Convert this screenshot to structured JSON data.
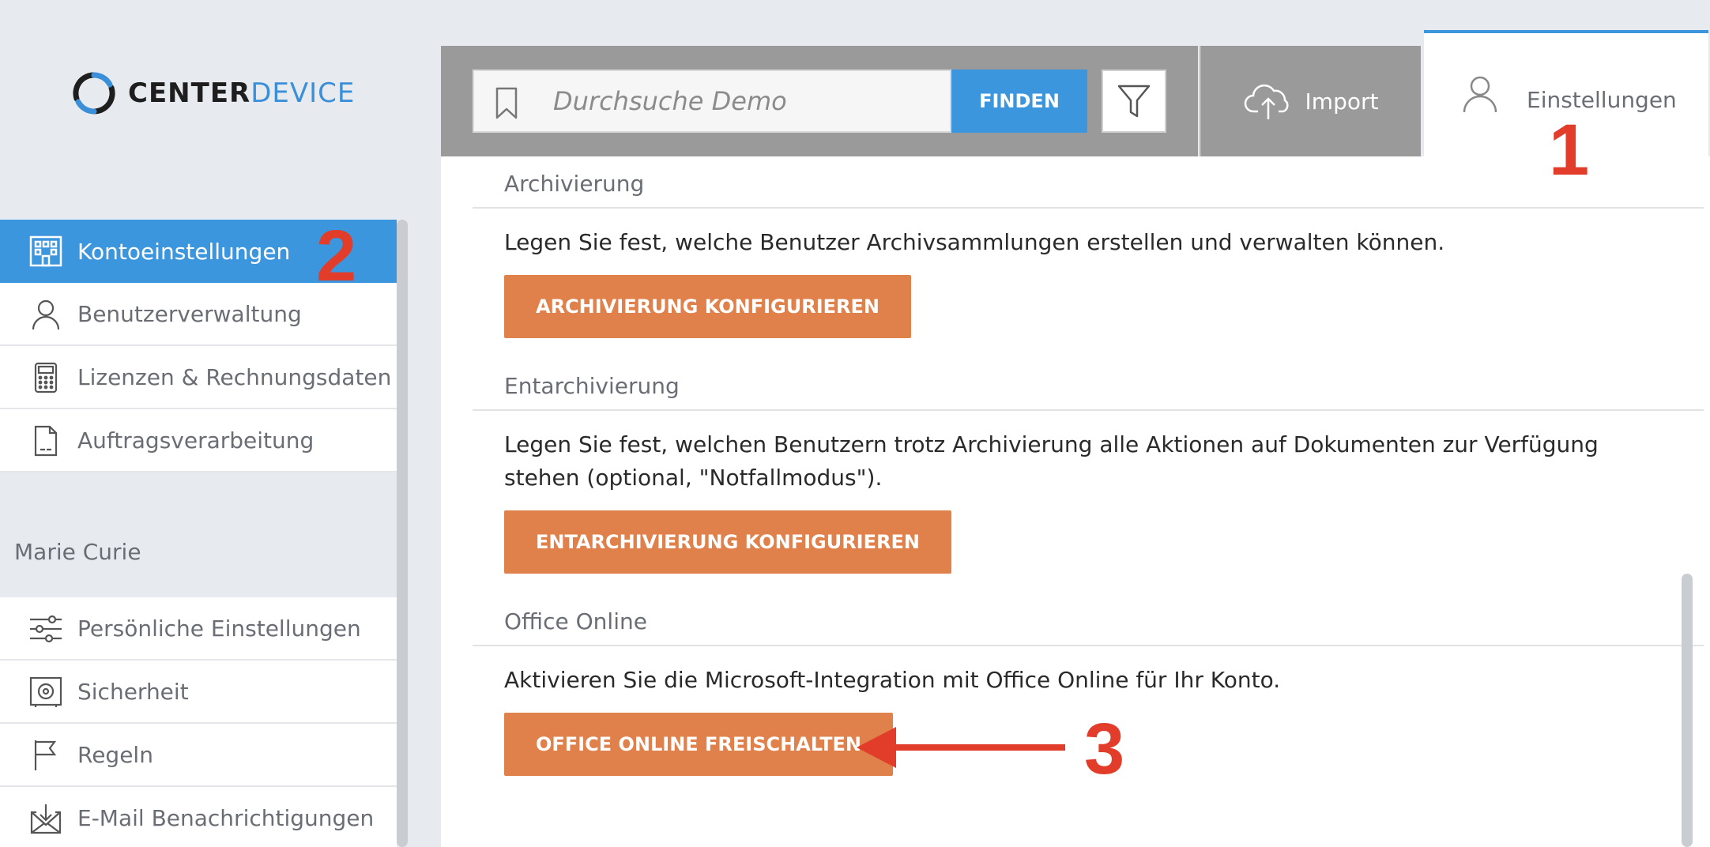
{
  "brand": {
    "name_part1": "CENTER",
    "name_part2": "DEVICE"
  },
  "search": {
    "placeholder": "Durchsuche Demo",
    "find_label": "FINDEN"
  },
  "tabs": {
    "import_label": "Import",
    "settings_label": "Einstellungen"
  },
  "sidebar": {
    "account_items": [
      {
        "label": "Kontoeinstellungen",
        "icon": "building-icon",
        "active": true
      },
      {
        "label": "Benutzerverwaltung",
        "icon": "user-icon"
      },
      {
        "label": "Lizenzen & Rechnungsdaten",
        "icon": "calculator-icon"
      },
      {
        "label": "Auftragsverarbeitung",
        "icon": "document-icon"
      }
    ],
    "user_name": "Marie Curie",
    "personal_items": [
      {
        "label": "Persönliche Einstellungen",
        "icon": "sliders-icon"
      },
      {
        "label": "Sicherheit",
        "icon": "safe-icon"
      },
      {
        "label": "Regeln",
        "icon": "flag-icon"
      },
      {
        "label": "E-Mail Benachrichtigungen",
        "icon": "inbox-icon"
      }
    ]
  },
  "main": {
    "sections": [
      {
        "title": "Archivierung",
        "description": "Legen Sie fest, welche Benutzer Archivsammlungen erstellen und verwalten können.",
        "button": "ARCHIVIERUNG KONFIGURIEREN"
      },
      {
        "title": "Entarchivierung",
        "description": "Legen Sie fest, welchen Benutzern trotz Archivierung alle Aktionen auf Dokumenten zur Verfügung stehen (optional, \"Notfallmodus\").",
        "button": "ENTARCHIVIERUNG KONFIGURIEREN"
      },
      {
        "title": "Office Online",
        "description": "Aktivieren Sie die Microsoft-Integration mit Office Online für Ihr Konto.",
        "button": "OFFICE ONLINE FREISCHALTEN"
      }
    ]
  },
  "annotations": {
    "step1": "1",
    "step2": "2",
    "step3": "3",
    "color": "#e23d2a"
  },
  "colors": {
    "accent_blue": "#3c96dd",
    "button_orange": "#e0804a",
    "topbar_gray": "#9a9a9a"
  }
}
